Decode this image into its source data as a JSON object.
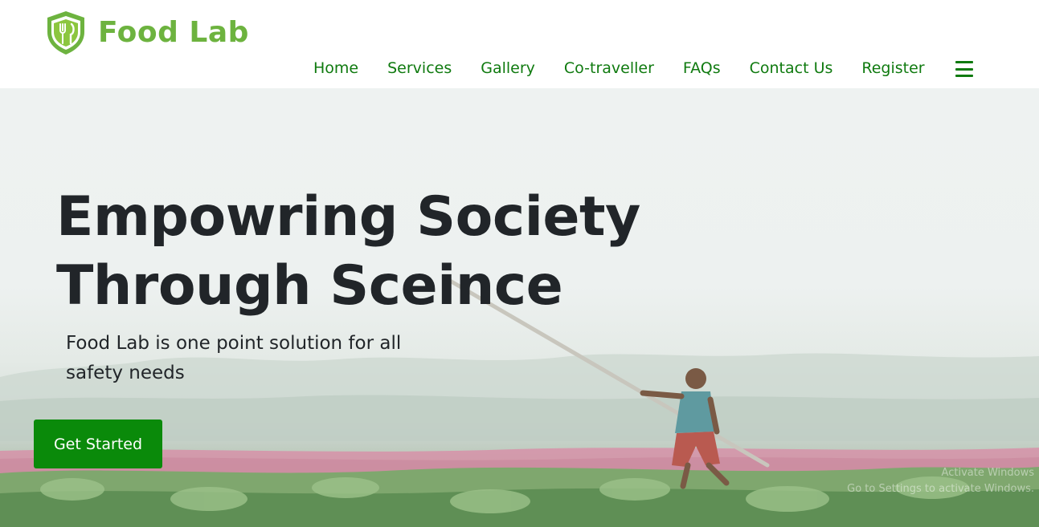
{
  "brand": {
    "name": "Food Lab",
    "color": "#6db33f"
  },
  "nav": {
    "items": [
      {
        "label": "Home"
      },
      {
        "label": "Services"
      },
      {
        "label": "Gallery"
      },
      {
        "label": "Co-traveller"
      },
      {
        "label": "FAQs"
      },
      {
        "label": "Contact Us"
      },
      {
        "label": "Register"
      }
    ],
    "menu_icon": "hamburger-menu-icon",
    "link_color": "#0f7a0f"
  },
  "hero": {
    "title_line1": "Empowring Society",
    "title_line2": "Through Sceince",
    "subtitle": "Food Lab is one point solution for all safety needs",
    "cta_label": "Get Started",
    "cta_color": "#0a8a0a"
  },
  "watermark": {
    "line1": "Activate Windows",
    "line2": "Go to Settings to activate Windows."
  }
}
